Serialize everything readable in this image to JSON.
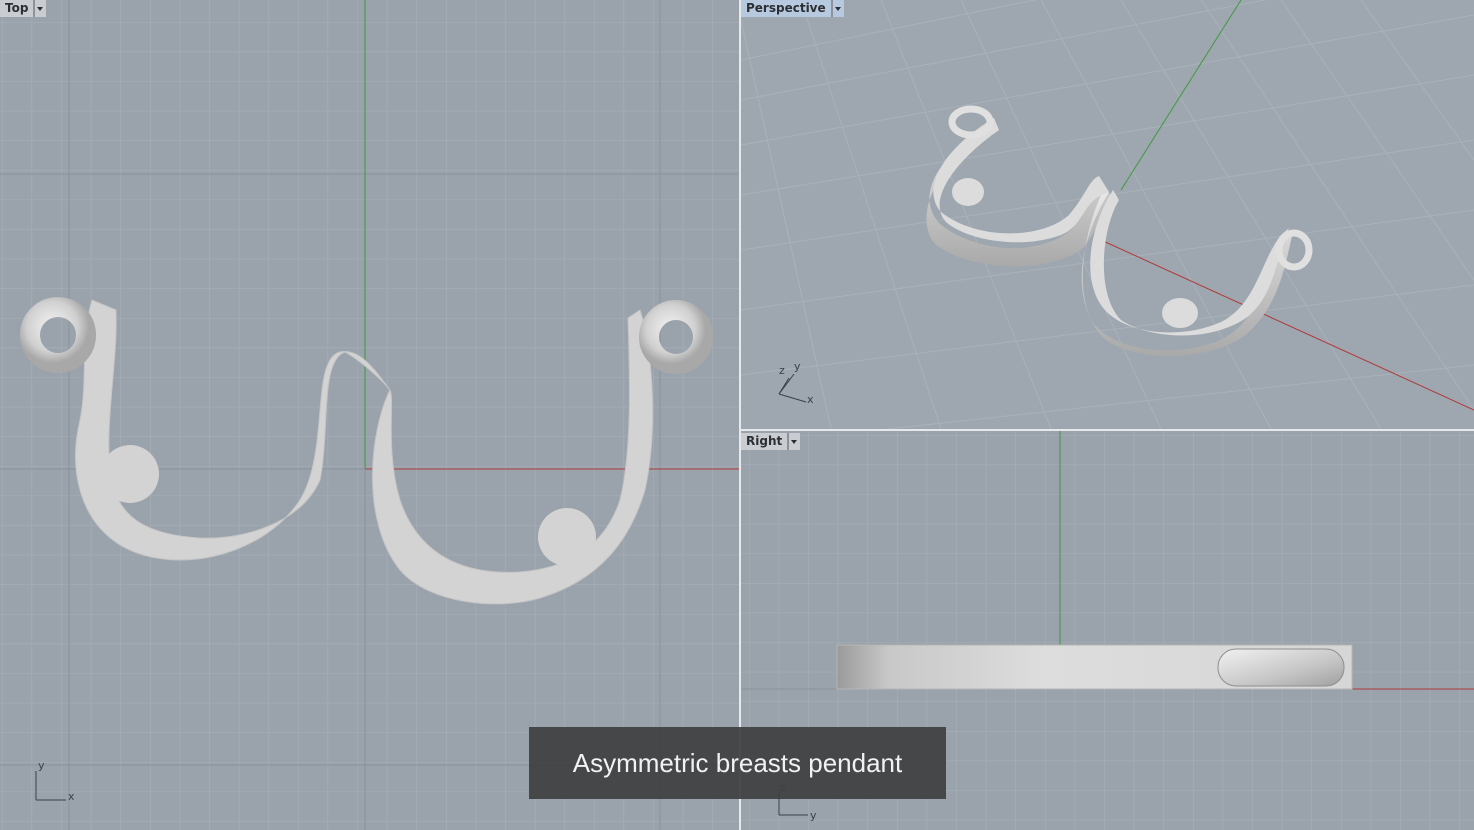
{
  "viewports": {
    "top": {
      "label": "Top",
      "axis_x": "x",
      "axis_y": "y"
    },
    "perspective": {
      "label": "Perspective",
      "axis_x": "x",
      "axis_y": "y",
      "axis_z": "z"
    },
    "right": {
      "label": "Right",
      "axis_y": "y",
      "axis_z": "z"
    }
  },
  "caption": "Asymmetric breasts pendant",
  "colors": {
    "background": "#9aa3ac",
    "grid_minor": "#a9b1b9",
    "grid_major": "#8b949d",
    "axis_x": "#b03a3a",
    "axis_y": "#3aa03a",
    "model": "#d4d4d4",
    "active_tab": "#b6c9de"
  },
  "icons": [
    "viewport-menu-arrow-icon",
    "axis-gizmo-icon"
  ]
}
